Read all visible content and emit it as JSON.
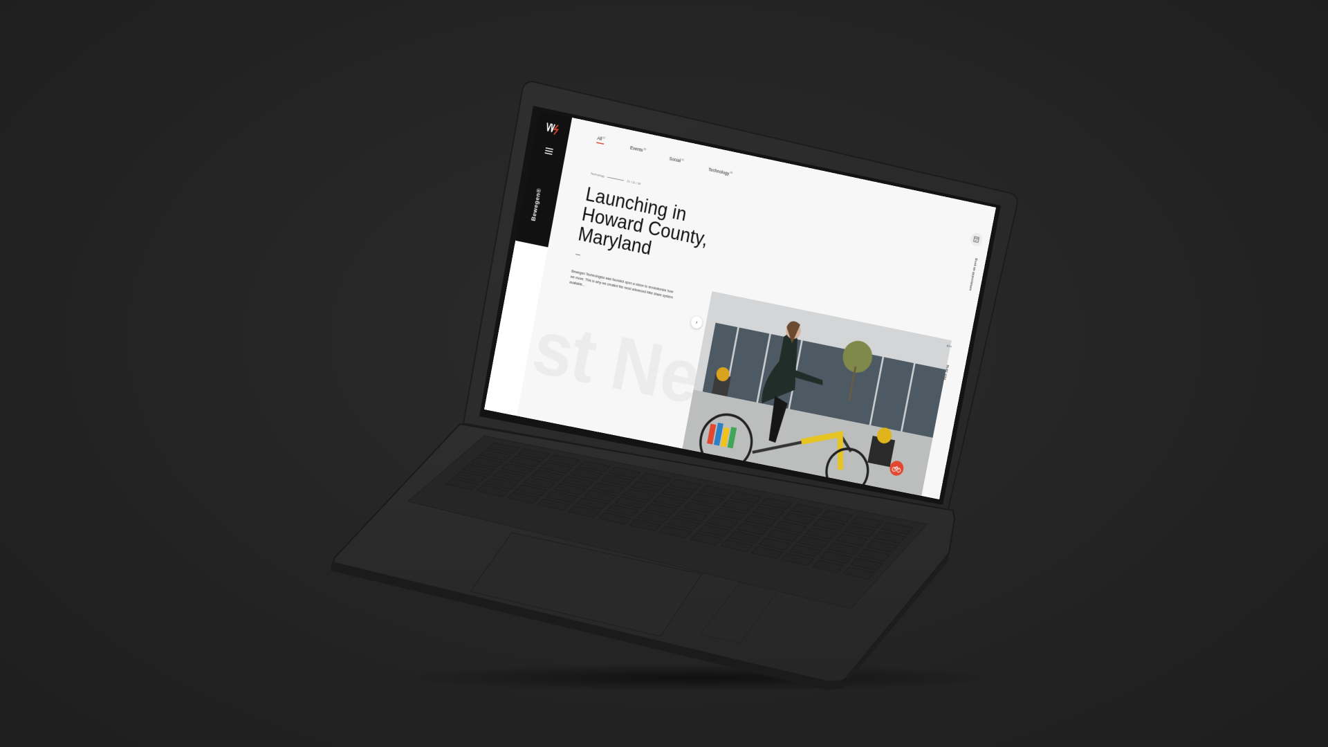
{
  "sidebar": {
    "brand": "Bewegen®"
  },
  "filters": [
    {
      "label": "All",
      "count": "37",
      "active": true
    },
    {
      "label": "Events",
      "count": "09",
      "active": false
    },
    {
      "label": "Social",
      "count": "16",
      "active": false
    },
    {
      "label": "Technology",
      "count": "08",
      "active": false
    }
  ],
  "article": {
    "category": "Technology",
    "date": "21 / 11 / 16",
    "title": "Launching in Howard County, Maryland",
    "excerpt": "Bewegen Technologies was founded upon a vision to revolutionize how we move. This is why we created the most advanced bike share system available...",
    "background_text": "st Ne"
  },
  "right_rail": {
    "book_label": "Book an appointment",
    "build_label": "Build your",
    "lang": "EN"
  },
  "colors": {
    "accent": "#e2472f",
    "background": "#252525",
    "laptop_body": "#2b2b2b",
    "screen_bg": "#f7f7f7"
  }
}
